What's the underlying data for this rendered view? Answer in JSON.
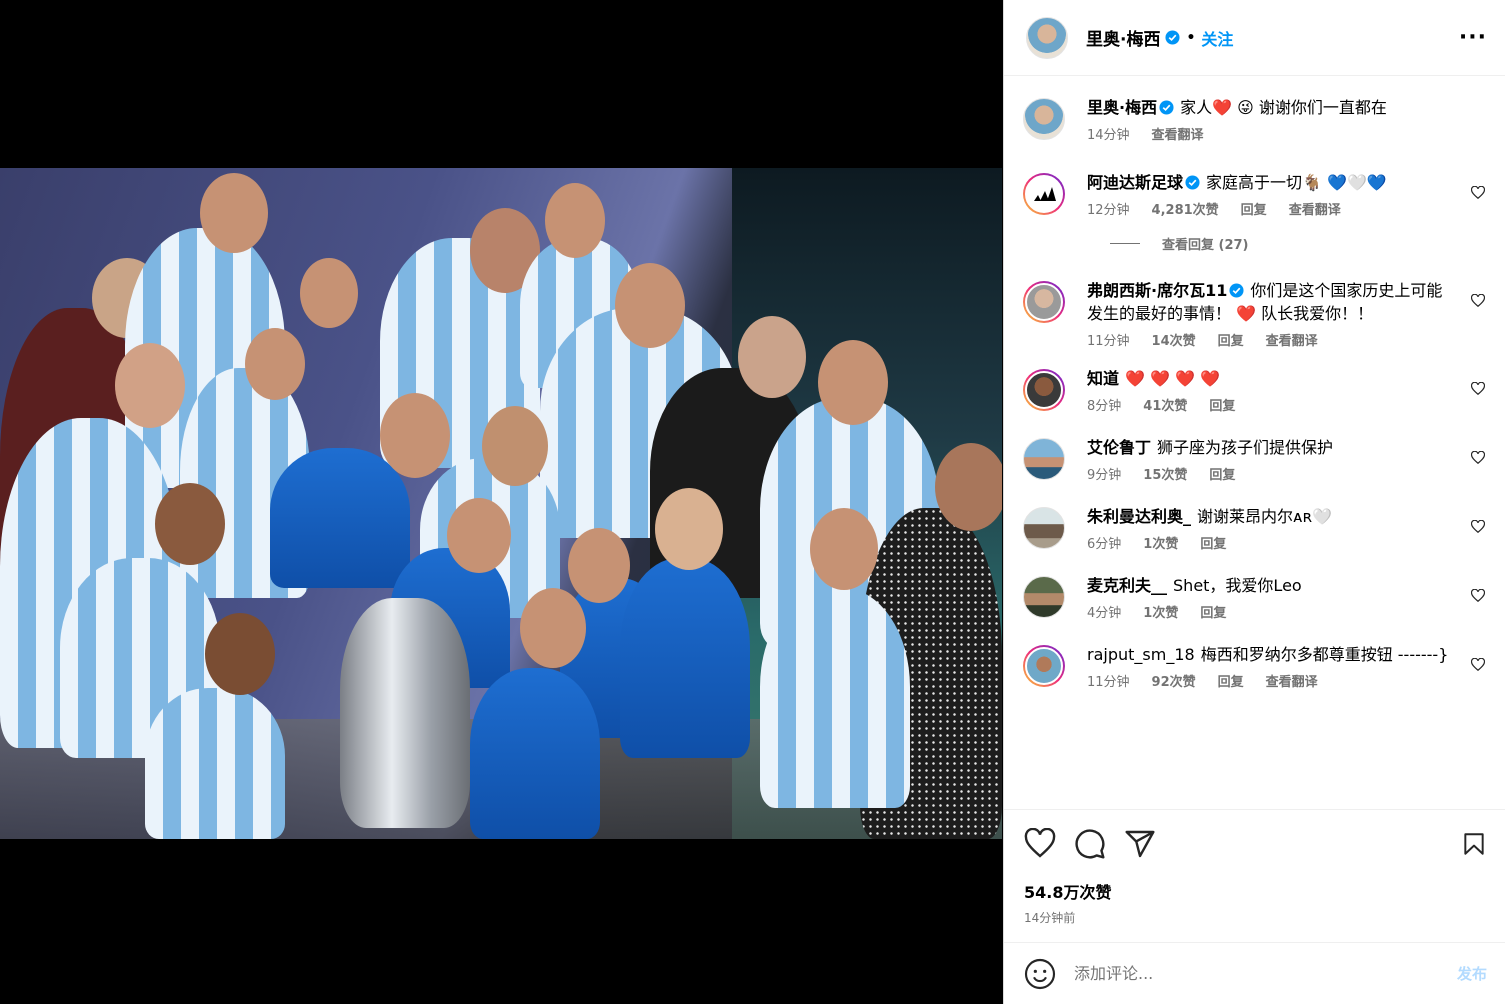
{
  "header": {
    "username": "里奥·梅西",
    "separator": "•",
    "follow_label": "关注",
    "more_label": "···"
  },
  "caption": {
    "username": "里奥·梅西",
    "text": "家人❤️ 😜 谢谢你们一直都在",
    "time": "14分钟",
    "translate": "查看翻译"
  },
  "comments": [
    {
      "username": "阿迪达斯足球",
      "verified": true,
      "text": "家庭高于一切🐐 💙🤍💙",
      "time": "12分钟",
      "likes": "4,281次赞",
      "reply": "回复",
      "translate": "查看翻译",
      "view_replies": "查看回复 (27)"
    },
    {
      "username": "弗朗西斯·席尔瓦11",
      "verified": true,
      "text": "你们是这个国家历史上可能发生的最好的事情！ ❤️ 队长我爱你！！",
      "time": "11分钟",
      "likes": "14次赞",
      "reply": "回复",
      "translate": "查看翻译"
    },
    {
      "username": "知道",
      "verified": false,
      "text": "❤️ ❤️ ❤️ ❤️",
      "time": "8分钟",
      "likes": "41次赞",
      "reply": "回复"
    },
    {
      "username": "艾伦鲁丁",
      "verified": false,
      "text": "狮子座为孩子们提供保护",
      "time": "9分钟",
      "likes": "15次赞",
      "reply": "回复"
    },
    {
      "username": "朱利曼达利奥_",
      "verified": false,
      "text": "谢谢莱昂内尔ᴀʀ🤍",
      "time": "6分钟",
      "likes": "1次赞",
      "reply": "回复"
    },
    {
      "username": "麦克利夫__",
      "verified": false,
      "text": "Shet，我爱你Leo",
      "time": "4分钟",
      "likes": "1次赞",
      "reply": "回复"
    },
    {
      "username": "rajput_sm_18",
      "verified": false,
      "text": "梅西和罗纳尔多都尊重按钮 -------}",
      "time": "11分钟",
      "likes": "92次赞",
      "reply": "回复",
      "translate": "查看翻译"
    }
  ],
  "footer": {
    "likes": "54.8万次赞",
    "time_ago": "14分钟前",
    "comment_placeholder": "添加评论...",
    "post_label": "发布"
  },
  "colors": {
    "accent": "#0095f6",
    "muted": "#737373",
    "heart": "#ed4956"
  },
  "icons": [
    "verified-icon",
    "more-icon",
    "heart-icon",
    "comment-icon",
    "share-icon",
    "bookmark-icon",
    "emoji-icon"
  ]
}
